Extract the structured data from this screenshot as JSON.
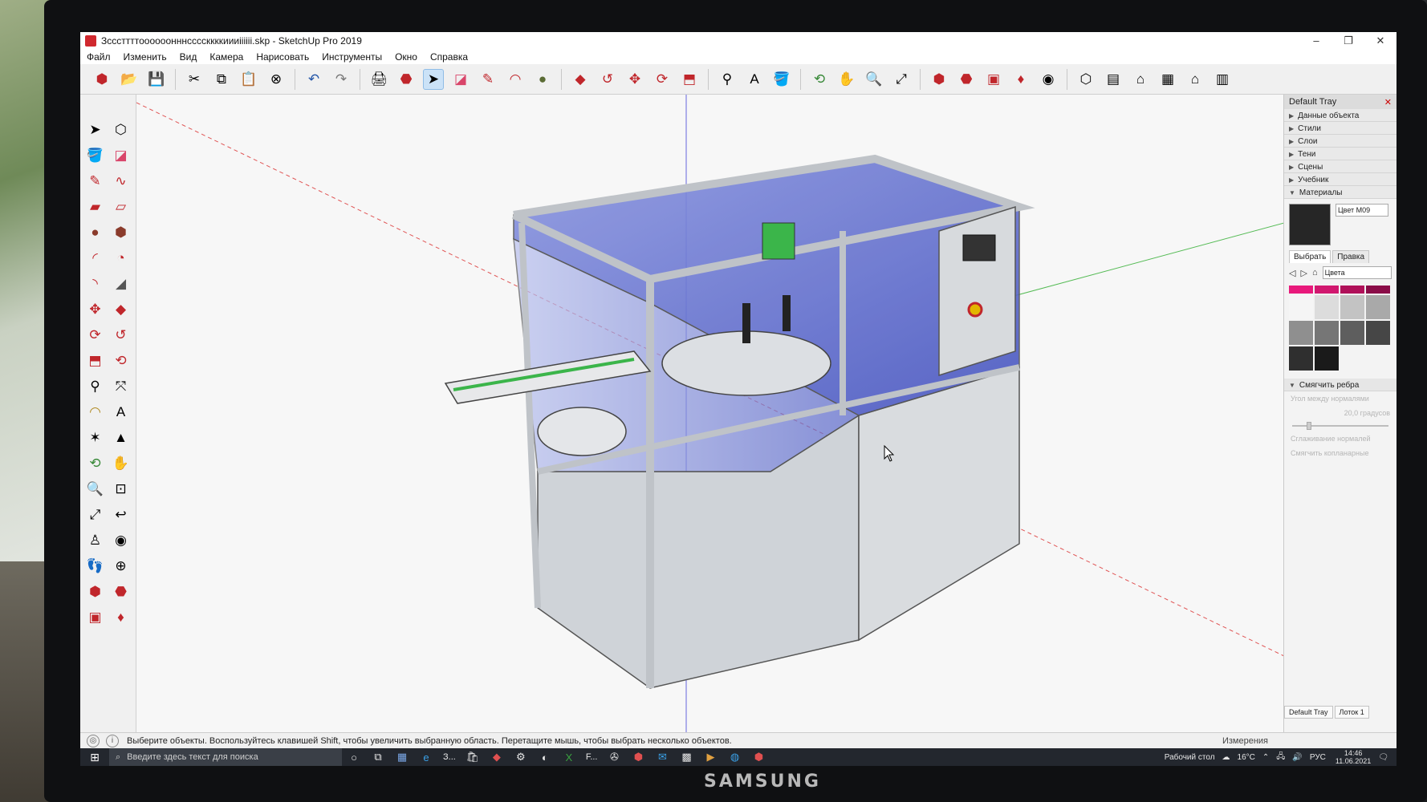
{
  "window": {
    "title": "Зсссттттоооооонннссссккккиииiiiiii.skp - SketchUp Pro 2019",
    "controls": {
      "minimize": "–",
      "maximize": "❐",
      "close": "✕"
    }
  },
  "menu": [
    "Файл",
    "Изменить",
    "Вид",
    "Камера",
    "Нарисовать",
    "Инструменты",
    "Окно",
    "Справка"
  ],
  "toolbar_icons": [
    "get-started-icon",
    "open-icon",
    "save-icon",
    "cut-icon",
    "copy-icon",
    "paste-icon",
    "erase-icon",
    "undo-icon",
    "redo-icon",
    "print-icon",
    "model-info-icon",
    "select-icon",
    "eraser-icon",
    "pencil-icon",
    "arc-icon",
    "circle-icon",
    "push-pull-icon",
    "follow-me-icon",
    "move-icon",
    "rotate-icon",
    "scale-icon",
    "tape-icon",
    "text-icon",
    "paint-icon",
    "orbit-icon",
    "pan-icon",
    "zoom-icon",
    "zoom-extents-icon",
    "warehouse-icon",
    "extension-icon",
    "layout-icon",
    "ruby-icon",
    "account-icon",
    "iso-icon",
    "top-icon",
    "front-icon",
    "right-icon",
    "back-icon",
    "left-icon"
  ],
  "left_tool_icons": [
    "select-icon",
    "component-icon",
    "paint-icon",
    "eraser-icon",
    "line-icon",
    "freehand-icon",
    "rectangle-icon",
    "rotated-rect-icon",
    "circle-icon",
    "polygon-icon",
    "arc-icon",
    "pie-icon",
    "arc3-icon",
    "offset-icon",
    "move-icon",
    "push-pull-icon",
    "rotate-icon",
    "follow-me-icon",
    "scale-icon",
    "offset2-icon",
    "tape-icon",
    "dimension-icon",
    "protractor-icon",
    "text-icon",
    "axes-icon",
    "3dtext-icon",
    "orbit-icon",
    "pan-icon",
    "zoom-icon",
    "zoom-window-icon",
    "zoom-extents-icon",
    "previous-icon",
    "position-camera-icon",
    "look-around-icon",
    "walk-icon",
    "section-icon",
    "warehouse-icon",
    "extension-icon",
    "layout-icon",
    "ruby-icon"
  ],
  "tray": {
    "title": "Default Tray",
    "sections": [
      "Данные объекта",
      "Стили",
      "Слои",
      "Тени",
      "Сцены",
      "Учебник",
      "Материалы"
    ],
    "material_name": "Цвет M09",
    "material_tabs": [
      "Выбрать",
      "Правка"
    ],
    "material_library": "Цвета",
    "swatch_colors": [
      "#e8197b",
      "#d1186f",
      "#b01059",
      "#8a0c48",
      "#f5f5f5",
      "#dcdcdc",
      "#c3c3c3",
      "#a9a9a9",
      "#8f8f8f",
      "#767676",
      "#5e5e5e",
      "#464646",
      "#2f2f2f",
      "#1a1a1a"
    ],
    "soften_title": "Смягчить ребра",
    "soften_angle_label": "Угол между нормалями",
    "soften_angle_value": "20,0 градусов",
    "soften_opt1": "Сглаживание нормалей",
    "soften_opt2": "Смягчить копланарные",
    "bottom_tabs": [
      "Default Tray",
      "Лоток 1"
    ]
  },
  "status": {
    "message": "Выберите объекты. Воспользуйтесь клавишей Shift, чтобы увеличить выбранную область. Перетащите мышь, чтобы выбрать несколько объектов.",
    "measurements_label": "Измерения"
  },
  "taskbar": {
    "search_placeholder": "Введите здесь текст для поиска",
    "app_labels": [
      "З...",
      "F..."
    ],
    "desktop_label": "Рабочий стол",
    "weather": "16°C",
    "language": "РУС",
    "time": "14:46",
    "date": "11.06.2021"
  },
  "monitor_brand": "SAMSUNG",
  "colors": {
    "frame": "#bfc3c8",
    "glass": "#5a68c8",
    "panel": "#cfd3d8",
    "green": "#3bb54a",
    "red_axis": "#d44",
    "green_axis": "#4a4",
    "blue_axis": "#44c"
  }
}
